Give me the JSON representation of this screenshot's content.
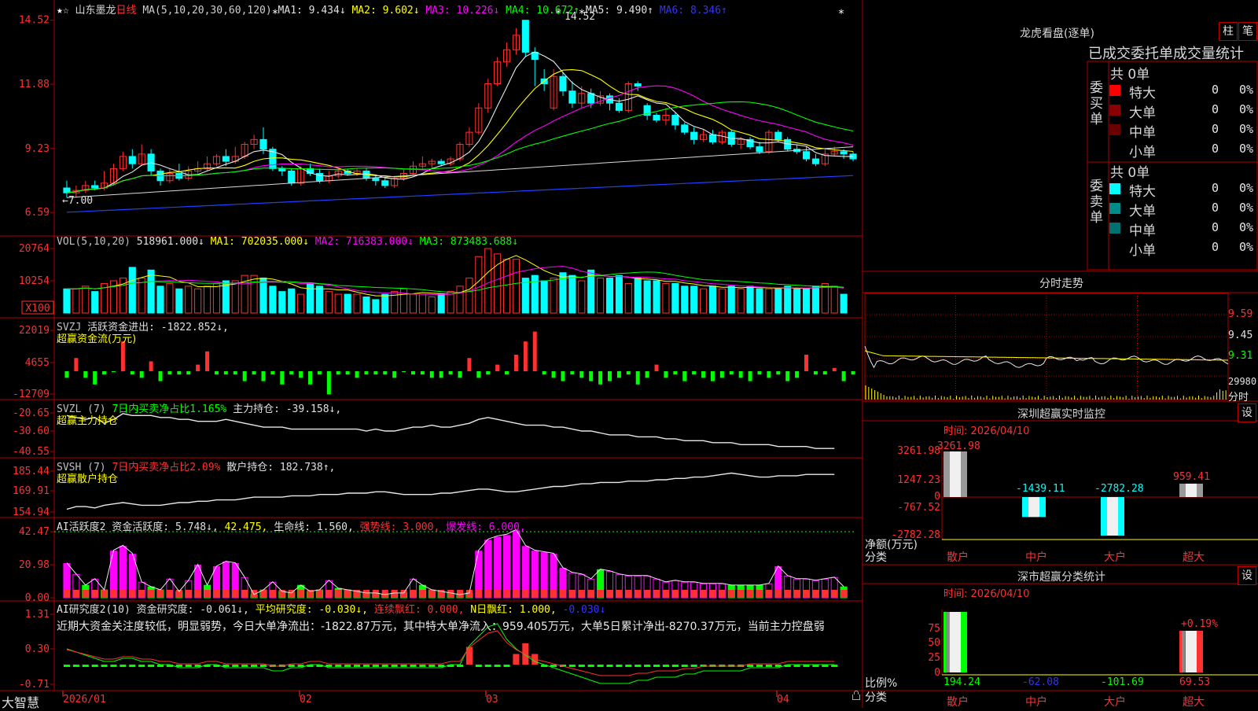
{
  "stock": {
    "name": "山东墨龙",
    "period": "日线",
    "star_glyph": "★",
    "outline_star_glyph": "☆",
    "ma_header": {
      "label": "MA(5,10,20,30,60,120)",
      "items": [
        {
          "text": "MA1: 9.434↓",
          "color": "#e0e0e0"
        },
        {
          "text": "MA2: 9.602↓",
          "color": "#ffff00"
        },
        {
          "text": "MA3: 10.226↓",
          "color": "#ff00ff"
        },
        {
          "text": "MA4: 10.672↑",
          "color": "#00ff00"
        },
        {
          "text": "MA5: 9.490↑",
          "color": "#e0e0e0"
        },
        {
          "text": "MA6: 8.346↑",
          "color": "#3333ff"
        }
      ]
    },
    "high_label": "14.52",
    "low_label": "7.00"
  },
  "colors": {
    "up": "#ff3030",
    "down": "#00ffff",
    "green": "#00ff00",
    "magenta": "#ff00ff",
    "yellow": "#ffff00",
    "white": "#e8e8e8",
    "blue": "#2040ff",
    "grid_border": "#b00000",
    "axis_text": "#ff3030"
  },
  "panels": {
    "price": {
      "ticks": [
        "14.52",
        "11.88",
        "9.23",
        "6.59"
      ],
      "range": [
        6.4,
        14.9
      ]
    },
    "vol": {
      "ticks": [
        "20764",
        "10254",
        "X100"
      ],
      "header": [
        {
          "text": "VOL(5,10,20)",
          "color": "#c0c0c0"
        },
        {
          "text": "518961.000↓",
          "color": "#e0e0e0"
        },
        {
          "text": "MA1: 702035.000↓",
          "color": "#ffff00"
        },
        {
          "text": "MA2: 716383.000↓",
          "color": "#ff00ff"
        },
        {
          "text": "MA3: 873483.688↓",
          "color": "#00ff00"
        }
      ]
    },
    "svzj": {
      "ticks": [
        "22019",
        "4655",
        "-12709"
      ],
      "header": [
        {
          "text": "SVZJ",
          "color": "#c0c0c0"
        },
        {
          "text": "活跃资金进出: -1822.852↓,",
          "color": "#e0e0e0"
        }
      ],
      "sub": "超赢资金流(万元)"
    },
    "svzl": {
      "ticks": [
        "-20.65",
        "-30.60",
        "-40.55"
      ],
      "header": [
        {
          "text": "SVZL (7)",
          "color": "#c0c0c0"
        },
        {
          "text": "7日内买卖净占比1.165%",
          "color": "#00ff00"
        },
        {
          "text": "主力持仓: -39.158↓,",
          "color": "#e0e0e0"
        }
      ],
      "sub": "超赢主力持仓"
    },
    "svsh": {
      "ticks": [
        "185.44",
        "169.91",
        "154.94"
      ],
      "header": [
        {
          "text": "SVSH (7)",
          "color": "#c0c0c0"
        },
        {
          "text": "7日内买卖净占比2.09%",
          "color": "#ff3030"
        },
        {
          "text": "散户持仓: 182.738↑,",
          "color": "#e0e0e0"
        }
      ],
      "sub": "超赢散户持仓"
    },
    "ai1": {
      "ticks": [
        "42.47",
        "20.98",
        "0.00"
      ],
      "header": [
        {
          "text": "AI活跃度2 资金活跃度: 5.748↓,",
          "color": "#e0e0e0"
        },
        {
          "text": "42.475,",
          "color": "#ffff00"
        },
        {
          "text": "生命线: 1.560,",
          "color": "#e0e0e0"
        },
        {
          "text": "强势线: 3.000,",
          "color": "#ff3030"
        },
        {
          "text": "爆发线: 6.000,",
          "color": "#ff00ff"
        }
      ]
    },
    "ai2": {
      "ticks": [
        "1.31",
        "0.30",
        "-0.71"
      ],
      "header": [
        {
          "text": "AI研究度2(10) 资金研究度: -0.061↓,",
          "color": "#e0e0e0"
        },
        {
          "text": "平均研究度: -0.030↓,",
          "color": "#ffff00"
        },
        {
          "text": "连续飘红: 0.000,",
          "color": "#ff3030"
        },
        {
          "text": "N日飘红: 1.000,",
          "color": "#ffff00"
        },
        {
          "text": "-0.030↓",
          "color": "#3333ff"
        }
      ],
      "comment": "近期大资金关注度较低，明显弱势，今日大单净流出：-1822.87万元，其中特大单净流入：959.405万元，大单5日累计净出-8270.37万元，当前主力控盘弱"
    }
  },
  "xaxis": {
    "labels": [
      "2026/01",
      "02",
      "03",
      "04"
    ],
    "brand": "大智慧"
  },
  "right": {
    "lhb": {
      "title": "龙虎看盘(逐单)",
      "btn_bar": "柱",
      "btn_pen": "笔",
      "subtitle": "已成交委托单成交量统计",
      "buy": {
        "side_label": "委买单",
        "total": "共 0单",
        "rows": [
          {
            "name": "特大",
            "count": "0",
            "pct": "0%",
            "color": "#ff0000"
          },
          {
            "name": "大单",
            "count": "0",
            "pct": "0%",
            "color": "#8b0000"
          },
          {
            "name": "中单",
            "count": "0",
            "pct": "0%",
            "color": "#6a0000"
          },
          {
            "name": "小单",
            "count": "0",
            "pct": "0%",
            "color": "#000000"
          }
        ]
      },
      "sell": {
        "side_label": "委卖单",
        "total": "共 0单",
        "rows": [
          {
            "name": "特大",
            "count": "0",
            "pct": "0%",
            "color": "#00ffff"
          },
          {
            "name": "大单",
            "count": "0",
            "pct": "0%",
            "color": "#008b8b"
          },
          {
            "name": "中单",
            "count": "0",
            "pct": "0%",
            "color": "#007070"
          },
          {
            "name": "小单",
            "count": "0",
            "pct": "0%",
            "color": "#000000"
          }
        ]
      }
    },
    "intraday": {
      "title": "分时走势",
      "ticks": [
        "9.59",
        "9.45",
        "9.31",
        "29980",
        "分时"
      ]
    },
    "monitor": {
      "title": "深圳超赢实时监控",
      "btn": "设",
      "time": "时间: 2026/04/10",
      "yticks": [
        "3261.98",
        "1247.23",
        "0",
        "-767.52",
        "-2782.28"
      ],
      "ylabel": "净额(万元)",
      "xlabel": "分类",
      "cats": [
        "散户",
        "中户",
        "大户",
        "超大"
      ],
      "values": [
        3261.98,
        -1439.11,
        -2782.28,
        959.41
      ],
      "value_labels": [
        "3261.98",
        "-1439.11",
        "-2782.28",
        "959.41"
      ],
      "range": [
        -2782.28,
        3261.98
      ]
    },
    "classify": {
      "title": "深市超赢分类统计",
      "btn": "设",
      "time": "时间: 2026/04/10",
      "yticks": [
        "75",
        "50",
        "25",
        "0"
      ],
      "ylabel": "比例%",
      "xlabel": "分类",
      "cats": [
        "散户",
        "中户",
        "大户",
        "超大"
      ],
      "bottom_values": [
        "194.24",
        "-62.08",
        "-101.69",
        "69.53"
      ],
      "top_label": "+0.19%",
      "bars": [
        100,
        0,
        0,
        69.53
      ]
    }
  },
  "chart_data": {
    "type": "candlestick",
    "title": "山东墨龙 日线",
    "ylim": [
      6.4,
      14.9
    ],
    "candles": [
      [
        7.6,
        7.4,
        7.9,
        7.2
      ],
      [
        7.4,
        7.5,
        7.7,
        7.2
      ],
      [
        7.5,
        7.7,
        7.9,
        7.4
      ],
      [
        7.7,
        7.6,
        7.9,
        7.5
      ],
      [
        7.6,
        7.8,
        8.3,
        7.5
      ],
      [
        7.8,
        8.4,
        8.6,
        7.7
      ],
      [
        8.4,
        8.9,
        9.1,
        8.3
      ],
      [
        8.9,
        8.6,
        9.2,
        8.4
      ],
      [
        8.6,
        9.0,
        9.4,
        8.5
      ],
      [
        9.0,
        8.3,
        9.2,
        8.1
      ],
      [
        8.3,
        7.9,
        8.4,
        7.7
      ],
      [
        7.9,
        8.2,
        8.4,
        7.8
      ],
      [
        8.2,
        8.0,
        8.6,
        7.9
      ],
      [
        8.0,
        8.3,
        8.5,
        7.9
      ],
      [
        8.3,
        8.4,
        8.7,
        8.2
      ],
      [
        8.4,
        8.6,
        8.9,
        8.3
      ],
      [
        8.6,
        8.9,
        9.0,
        8.5
      ],
      [
        8.9,
        8.7,
        9.2,
        8.5
      ],
      [
        8.7,
        8.9,
        9.3,
        8.6
      ],
      [
        8.9,
        9.4,
        9.5,
        8.8
      ],
      [
        9.4,
        9.6,
        9.8,
        9.2
      ],
      [
        9.6,
        9.2,
        10.1,
        9.0
      ],
      [
        9.2,
        8.4,
        9.3,
        8.3
      ],
      [
        8.4,
        8.3,
        8.5,
        8.1
      ],
      [
        8.3,
        7.8,
        8.4,
        7.7
      ],
      [
        7.8,
        8.4,
        8.5,
        7.7
      ],
      [
        8.4,
        8.2,
        8.6,
        8.1
      ],
      [
        8.2,
        7.9,
        8.4,
        7.8
      ],
      [
        7.9,
        8.1,
        8.3,
        7.8
      ],
      [
        8.1,
        8.3,
        8.4,
        8.0
      ],
      [
        8.3,
        8.2,
        8.4,
        8.1
      ],
      [
        8.2,
        8.3,
        8.4,
        8.1
      ],
      [
        8.3,
        8.0,
        8.4,
        7.9
      ],
      [
        8.0,
        7.9,
        8.1,
        7.7
      ],
      [
        7.9,
        7.7,
        8.0,
        7.6
      ],
      [
        7.7,
        8.0,
        8.1,
        7.6
      ],
      [
        8.0,
        8.2,
        8.4,
        7.9
      ],
      [
        8.2,
        8.5,
        8.7,
        8.1
      ],
      [
        8.5,
        8.6,
        8.9,
        8.4
      ],
      [
        8.6,
        8.7,
        8.8,
        8.4
      ],
      [
        8.7,
        8.6,
        8.8,
        8.5
      ],
      [
        8.6,
        8.8,
        8.9,
        8.5
      ],
      [
        8.8,
        9.4,
        9.5,
        8.7
      ],
      [
        9.4,
        9.9,
        10.1,
        9.3
      ],
      [
        9.9,
        10.9,
        11.1,
        9.8
      ],
      [
        10.9,
        11.9,
        12.1,
        10.7
      ],
      [
        11.9,
        12.8,
        13.0,
        11.8
      ],
      [
        12.8,
        13.3,
        13.6,
        12.6
      ],
      [
        13.3,
        13.9,
        14.2,
        13.1
      ],
      [
        14.52,
        13.2,
        14.52,
        13.0
      ],
      [
        13.2,
        12.9,
        13.4,
        11.8
      ],
      [
        12.1,
        11.9,
        12.5,
        11.6
      ],
      [
        10.9,
        12.2,
        12.5,
        10.8
      ],
      [
        12.2,
        11.6,
        12.4,
        11.4
      ],
      [
        11.6,
        11.1,
        12.0,
        10.9
      ],
      [
        11.1,
        11.5,
        11.8,
        10.9
      ],
      [
        11.5,
        11.1,
        11.7,
        10.9
      ],
      [
        11.1,
        11.4,
        11.6,
        11.0
      ],
      [
        11.4,
        11.1,
        11.5,
        10.8
      ],
      [
        11.1,
        10.8,
        11.3,
        10.7
      ],
      [
        10.8,
        11.9,
        12.0,
        10.7
      ],
      [
        11.9,
        11.8,
        12.0,
        11.6
      ],
      [
        11.0,
        10.6,
        11.1,
        10.4
      ],
      [
        10.6,
        10.4,
        10.7,
        10.3
      ],
      [
        10.4,
        10.6,
        10.9,
        10.2
      ],
      [
        10.6,
        10.2,
        10.7,
        10.0
      ],
      [
        10.2,
        9.9,
        10.3,
        9.8
      ],
      [
        9.9,
        9.6,
        10.1,
        9.4
      ],
      [
        9.6,
        9.8,
        10.0,
        9.5
      ],
      [
        9.8,
        9.5,
        10.0,
        9.4
      ],
      [
        9.5,
        9.9,
        10.0,
        9.4
      ],
      [
        9.9,
        9.4,
        10.0,
        9.3
      ],
      [
        9.4,
        9.6,
        9.7,
        9.2
      ],
      [
        9.6,
        9.3,
        9.7,
        9.2
      ],
      [
        9.3,
        9.1,
        9.5,
        9.0
      ],
      [
        9.1,
        9.9,
        10.0,
        9.0
      ],
      [
        9.9,
        9.6,
        10.0,
        9.5
      ],
      [
        9.6,
        9.2,
        9.7,
        9.1
      ],
      [
        9.2,
        9.1,
        9.4,
        9.0
      ],
      [
        9.1,
        8.8,
        9.3,
        8.7
      ],
      [
        8.8,
        8.6,
        9.0,
        8.5
      ],
      [
        8.6,
        9.0,
        9.2,
        8.5
      ],
      [
        9.0,
        9.1,
        9.3,
        8.9
      ],
      [
        9.1,
        9.0,
        9.2,
        8.8
      ],
      [
        9.0,
        8.8,
        9.1,
        8.7
      ]
    ],
    "volume": [
      9,
      9,
      10,
      8,
      11,
      12,
      13,
      17,
      13,
      16,
      10,
      11,
      9,
      10,
      9,
      10,
      11,
      12,
      12,
      14,
      14,
      13,
      10,
      8,
      9,
      7,
      11,
      10,
      8,
      7,
      7,
      7,
      6,
      5,
      7,
      8,
      9,
      7,
      7,
      6,
      7,
      8,
      10,
      13,
      21,
      24,
      22,
      20,
      20,
      13,
      14,
      12,
      13,
      15,
      14,
      12,
      16,
      13,
      13,
      14,
      11,
      13,
      12,
      12,
      11,
      11,
      10,
      10,
      9,
      10,
      9,
      10,
      9,
      10,
      9,
      9,
      9,
      10,
      9,
      9,
      10,
      11,
      10,
      7
    ],
    "svzj": [
      -2,
      4,
      -2,
      -4,
      -1,
      0,
      9,
      -1,
      -2,
      3,
      -3,
      -1,
      -1,
      -1,
      2,
      6,
      -1,
      -1,
      -1,
      -3,
      -1,
      -3,
      -1,
      -4,
      -1,
      -2,
      -4,
      -1,
      -7,
      -1,
      -1,
      -2,
      -1,
      -1,
      -1,
      -2,
      0,
      -1,
      -1,
      -2,
      -2,
      -1,
      -2,
      4,
      -2,
      -1,
      2,
      -1,
      5,
      9,
      12,
      -1,
      -2,
      -3,
      -1,
      -2,
      -3,
      -4,
      -3,
      -2,
      -1,
      -4,
      -2,
      2,
      -2,
      -1,
      -3,
      -1,
      -2,
      -3,
      -2,
      -1,
      -2,
      -3,
      -1,
      -2,
      -1,
      -3,
      -2,
      5,
      -1,
      -1,
      1,
      -3,
      -1,
      -2,
      2,
      -1,
      -1,
      -1,
      -2,
      1,
      -1
    ],
    "svzl": [
      -22,
      -23,
      -24,
      -23,
      -26,
      -24,
      -21,
      -22,
      -22,
      -22,
      -23,
      -23,
      -24,
      -24,
      -25,
      -25,
      -25,
      -24,
      -25,
      -26,
      -27,
      -28,
      -28,
      -28,
      -29,
      -29,
      -29,
      -29,
      -29,
      -29,
      -29,
      -29,
      -30,
      -29,
      -30,
      -30,
      -29,
      -28,
      -28,
      -27,
      -28,
      -28,
      -27,
      -26,
      -24,
      -23,
      -24,
      -25,
      -26,
      -27,
      -27,
      -27,
      -28,
      -28,
      -29,
      -30,
      -30,
      -31,
      -32,
      -32,
      -32,
      -33,
      -33,
      -33,
      -34,
      -34,
      -35,
      -35,
      -35,
      -36,
      -36,
      -36,
      -37,
      -37,
      -37,
      -37,
      -38,
      -38,
      -38,
      -38,
      -39,
      -39,
      -39
    ],
    "svsh": [
      157,
      159,
      159,
      158,
      160,
      161,
      162,
      161,
      160,
      160,
      160,
      161,
      162,
      162,
      163,
      163,
      164,
      164,
      164,
      165,
      166,
      166,
      166,
      166,
      167,
      167,
      167,
      168,
      168,
      168,
      169,
      169,
      169,
      170,
      170,
      169,
      168,
      168,
      168,
      168,
      169,
      169,
      170,
      171,
      172,
      172,
      171,
      170,
      170,
      171,
      172,
      173,
      174,
      174,
      175,
      176,
      176,
      177,
      177,
      177,
      178,
      178,
      178,
      179,
      179,
      180,
      180,
      181,
      181,
      182,
      183,
      184,
      183,
      182,
      181,
      181,
      182,
      182,
      182,
      183,
      183,
      183,
      183
    ],
    "ai1": [
      22,
      15,
      8,
      12,
      5,
      30,
      33,
      28,
      10,
      7,
      5,
      12,
      4,
      11,
      21,
      8,
      20,
      23,
      22,
      13,
      2,
      5,
      10,
      4,
      3,
      8,
      4,
      5,
      11,
      6,
      5,
      4,
      3,
      3,
      2,
      3,
      3,
      12,
      8,
      5,
      4,
      3,
      2,
      3,
      30,
      37,
      39,
      40,
      43,
      33,
      30,
      29,
      28,
      19,
      16,
      15,
      12,
      18,
      17,
      15,
      14,
      14,
      14,
      12,
      10,
      11,
      10,
      10,
      9,
      9,
      9,
      8,
      8,
      8,
      8,
      9,
      20,
      14,
      12,
      12,
      11,
      12,
      13,
      7
    ],
    "ai2": [
      0.5,
      0.4,
      0.3,
      0.2,
      0.1,
      0.1,
      0.2,
      0.2,
      0.1,
      0.1,
      0.0,
      0.0,
      -0.1,
      -0.1,
      -0.1,
      0.0,
      0.0,
      -0.1,
      -0.1,
      -0.1,
      -0.1,
      -0.1,
      -0.2,
      -0.2,
      -0.1,
      -0.1,
      0.0,
      0.0,
      -0.1,
      -0.1,
      -0.1,
      -0.1,
      -0.1,
      -0.1,
      -0.1,
      -0.1,
      -0.1,
      -0.1,
      -0.1,
      -0.1,
      -0.1,
      0.0,
      0.0,
      0.6,
      0.9,
      1.2,
      1.3,
      0.8,
      0.5,
      0.3,
      0.1,
      0.0,
      -0.1,
      -0.2,
      -0.3,
      -0.4,
      -0.5,
      -0.6,
      -0.6,
      -0.6,
      -0.6,
      -0.5,
      -0.5,
      -0.4,
      -0.4,
      -0.4,
      -0.3,
      -0.3,
      -0.2,
      -0.2,
      -0.2,
      -0.2,
      -0.2,
      -0.1,
      -0.1,
      -0.1,
      -0.1,
      0.0,
      0.0,
      0.0,
      0.0,
      0.0,
      0.0
    ],
    "ai2_red": [
      0,
      0,
      0,
      0,
      0,
      0,
      0,
      0,
      0,
      0,
      0,
      0,
      0,
      0,
      0,
      0,
      0,
      0,
      0,
      0,
      0,
      0,
      0,
      0,
      0,
      0,
      0,
      0,
      0,
      0,
      0,
      0,
      0,
      0,
      0,
      0,
      0,
      0,
      0,
      0,
      0,
      0,
      0,
      0.5,
      0,
      0,
      0,
      0,
      0.3,
      0.6,
      0.3,
      0,
      0,
      0,
      0,
      0,
      0,
      0,
      0,
      0,
      0,
      0,
      0,
      0,
      0,
      0,
      0,
      0,
      0,
      0,
      0,
      0,
      0,
      0,
      0,
      0,
      0,
      0,
      0,
      0,
      0,
      0,
      0
    ]
  }
}
